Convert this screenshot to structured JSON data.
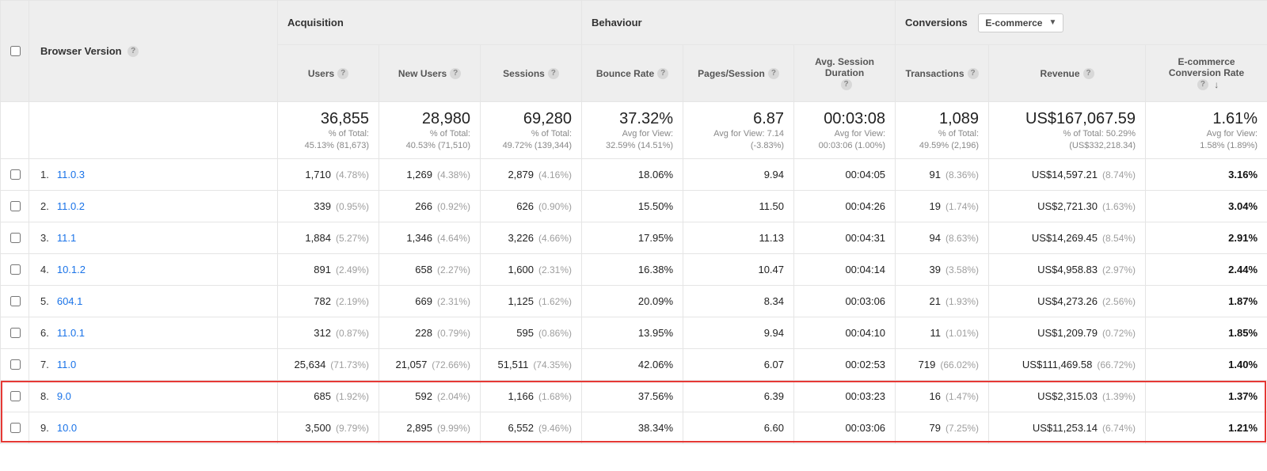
{
  "columns": {
    "dimension": "Browser Version",
    "groups": {
      "acquisition": "Acquisition",
      "behaviour": "Behaviour",
      "conversions": "Conversions"
    },
    "conversions_dropdown": "E-commerce",
    "metrics": {
      "users": "Users",
      "new_users": "New Users",
      "sessions": "Sessions",
      "bounce": "Bounce Rate",
      "pps": "Pages/Session",
      "asd": "Avg. Session Duration",
      "txn": "Transactions",
      "rev": "Revenue",
      "ecr": "E-commerce Conversion Rate"
    }
  },
  "summary": {
    "users": {
      "big": "36,855",
      "l1": "% of Total:",
      "l2": "45.13% (81,673)"
    },
    "new_users": {
      "big": "28,980",
      "l1": "% of Total:",
      "l2": "40.53% (71,510)"
    },
    "sessions": {
      "big": "69,280",
      "l1": "% of Total:",
      "l2": "49.72% (139,344)"
    },
    "bounce": {
      "big": "37.32%",
      "l1": "Avg for View:",
      "l2": "32.59% (14.51%)"
    },
    "pps": {
      "big": "6.87",
      "l1": "Avg for View: 7.14",
      "l2": "(-3.83%)"
    },
    "asd": {
      "big": "00:03:08",
      "l1": "Avg for View:",
      "l2": "00:03:06 (1.00%)"
    },
    "txn": {
      "big": "1,089",
      "l1": "% of Total:",
      "l2": "49.59% (2,196)"
    },
    "rev": {
      "big": "US$167,067.59",
      "l1": "% of Total: 50.29%",
      "l2": "(US$332,218.34)"
    },
    "ecr": {
      "big": "1.61%",
      "l1": "Avg for View:",
      "l2": "1.58% (1.89%)"
    }
  },
  "rows": [
    {
      "idx": "1.",
      "dim": "11.0.3",
      "users": "1,710",
      "users_p": "(4.78%)",
      "new_users": "1,269",
      "new_users_p": "(4.38%)",
      "sessions": "2,879",
      "sessions_p": "(4.16%)",
      "bounce": "18.06%",
      "pps": "9.94",
      "asd": "00:04:05",
      "txn": "91",
      "txn_p": "(8.36%)",
      "rev": "US$14,597.21",
      "rev_p": "(8.74%)",
      "ecr": "3.16%"
    },
    {
      "idx": "2.",
      "dim": "11.0.2",
      "users": "339",
      "users_p": "(0.95%)",
      "new_users": "266",
      "new_users_p": "(0.92%)",
      "sessions": "626",
      "sessions_p": "(0.90%)",
      "bounce": "15.50%",
      "pps": "11.50",
      "asd": "00:04:26",
      "txn": "19",
      "txn_p": "(1.74%)",
      "rev": "US$2,721.30",
      "rev_p": "(1.63%)",
      "ecr": "3.04%"
    },
    {
      "idx": "3.",
      "dim": "11.1",
      "users": "1,884",
      "users_p": "(5.27%)",
      "new_users": "1,346",
      "new_users_p": "(4.64%)",
      "sessions": "3,226",
      "sessions_p": "(4.66%)",
      "bounce": "17.95%",
      "pps": "11.13",
      "asd": "00:04:31",
      "txn": "94",
      "txn_p": "(8.63%)",
      "rev": "US$14,269.45",
      "rev_p": "(8.54%)",
      "ecr": "2.91%"
    },
    {
      "idx": "4.",
      "dim": "10.1.2",
      "users": "891",
      "users_p": "(2.49%)",
      "new_users": "658",
      "new_users_p": "(2.27%)",
      "sessions": "1,600",
      "sessions_p": "(2.31%)",
      "bounce": "16.38%",
      "pps": "10.47",
      "asd": "00:04:14",
      "txn": "39",
      "txn_p": "(3.58%)",
      "rev": "US$4,958.83",
      "rev_p": "(2.97%)",
      "ecr": "2.44%"
    },
    {
      "idx": "5.",
      "dim": "604.1",
      "users": "782",
      "users_p": "(2.19%)",
      "new_users": "669",
      "new_users_p": "(2.31%)",
      "sessions": "1,125",
      "sessions_p": "(1.62%)",
      "bounce": "20.09%",
      "pps": "8.34",
      "asd": "00:03:06",
      "txn": "21",
      "txn_p": "(1.93%)",
      "rev": "US$4,273.26",
      "rev_p": "(2.56%)",
      "ecr": "1.87%"
    },
    {
      "idx": "6.",
      "dim": "11.0.1",
      "users": "312",
      "users_p": "(0.87%)",
      "new_users": "228",
      "new_users_p": "(0.79%)",
      "sessions": "595",
      "sessions_p": "(0.86%)",
      "bounce": "13.95%",
      "pps": "9.94",
      "asd": "00:04:10",
      "txn": "11",
      "txn_p": "(1.01%)",
      "rev": "US$1,209.79",
      "rev_p": "(0.72%)",
      "ecr": "1.85%"
    },
    {
      "idx": "7.",
      "dim": "11.0",
      "users": "25,634",
      "users_p": "(71.73%)",
      "new_users": "21,057",
      "new_users_p": "(72.66%)",
      "sessions": "51,511",
      "sessions_p": "(74.35%)",
      "bounce": "42.06%",
      "pps": "6.07",
      "asd": "00:02:53",
      "txn": "719",
      "txn_p": "(66.02%)",
      "rev": "US$111,469.58",
      "rev_p": "(66.72%)",
      "ecr": "1.40%"
    },
    {
      "idx": "8.",
      "dim": "9.0",
      "users": "685",
      "users_p": "(1.92%)",
      "new_users": "592",
      "new_users_p": "(2.04%)",
      "sessions": "1,166",
      "sessions_p": "(1.68%)",
      "bounce": "37.56%",
      "pps": "6.39",
      "asd": "00:03:23",
      "txn": "16",
      "txn_p": "(1.47%)",
      "rev": "US$2,315.03",
      "rev_p": "(1.39%)",
      "ecr": "1.37%"
    },
    {
      "idx": "9.",
      "dim": "10.0",
      "users": "3,500",
      "users_p": "(9.79%)",
      "new_users": "2,895",
      "new_users_p": "(9.99%)",
      "sessions": "6,552",
      "sessions_p": "(9.46%)",
      "bounce": "38.34%",
      "pps": "6.60",
      "asd": "00:03:06",
      "txn": "79",
      "txn_p": "(7.25%)",
      "rev": "US$11,253.14",
      "rev_p": "(6.74%)",
      "ecr": "1.21%"
    }
  ],
  "highlight_dims": [
    "9.0",
    "10.0"
  ]
}
